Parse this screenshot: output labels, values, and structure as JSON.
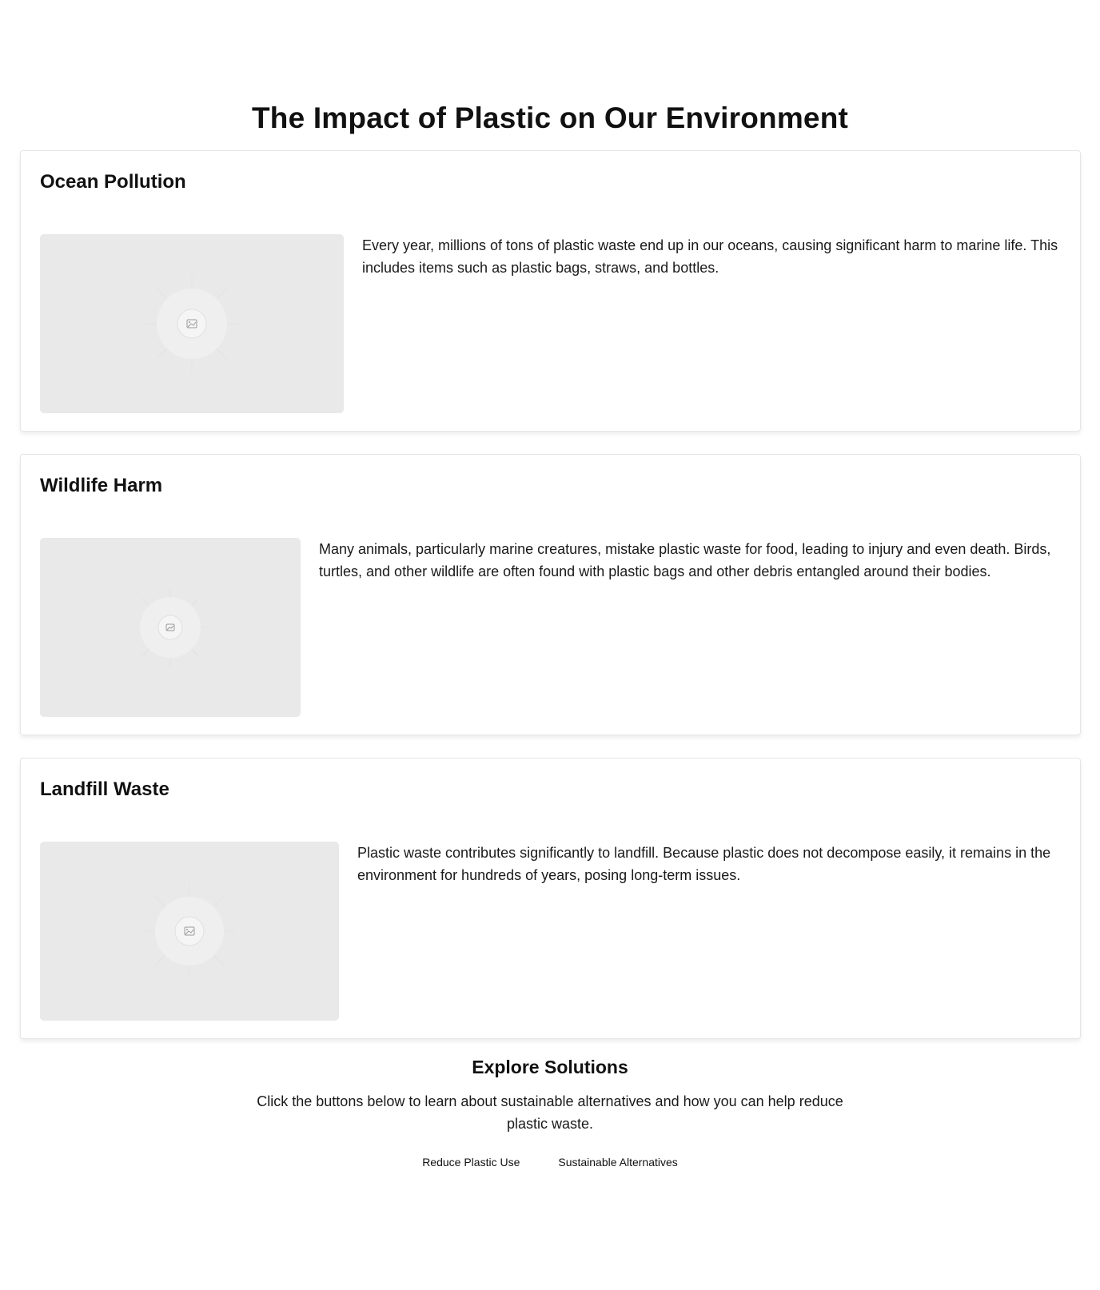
{
  "page": {
    "title": "The Impact of Plastic on Our Environment"
  },
  "sections": [
    {
      "title": "Ocean Pollution",
      "text": "Every year, millions of tons of plastic waste end up in our oceans, causing significant harm to marine life. This includes items such as plastic bags, straws, and bottles.",
      "image_icon": "image-placeholder-icon"
    },
    {
      "title": "Wildlife Harm",
      "text": "Many animals, particularly marine creatures, mistake plastic waste for food, leading to injury and even death. Birds, turtles, and other wildlife are often found with plastic bags and other debris entangled around their bodies.",
      "image_icon": "image-placeholder-icon"
    },
    {
      "title": "Landfill Waste",
      "text": "Plastic waste contributes significantly to landfill. Because plastic does not decompose easily, it remains in the environment for hundreds of years, posing long-term issues.",
      "image_icon": "image-placeholder-icon"
    }
  ],
  "solutions": {
    "title": "Explore Solutions",
    "text": "Click the buttons below to learn about sustainable alternatives and how you can help reduce plastic waste.",
    "buttons": [
      "Reduce Plastic Use",
      "Sustainable Alternatives"
    ]
  },
  "colors": {
    "background": "#ffffff",
    "text": "#111111",
    "placeholder": "#e9e9e9",
    "card_border": "#e6e6e6"
  }
}
